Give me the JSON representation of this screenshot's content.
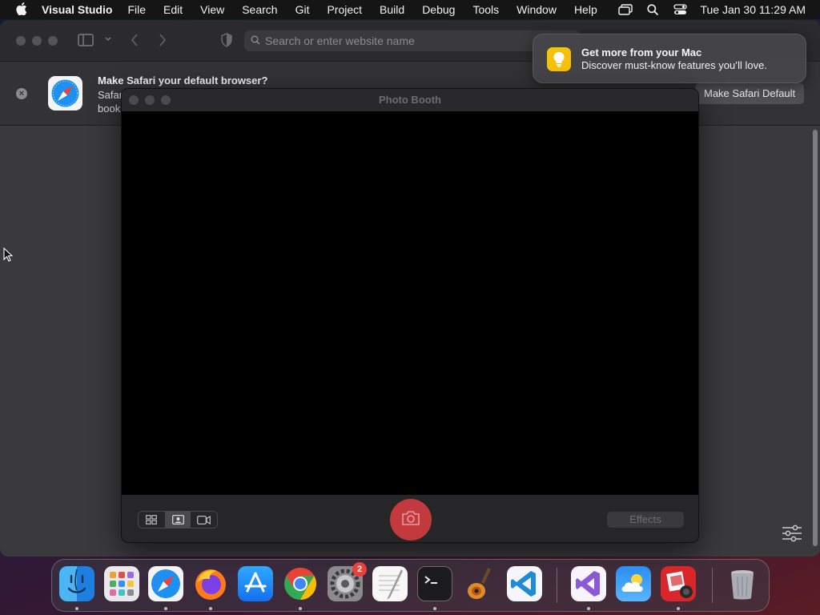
{
  "menubar": {
    "app_name": "Visual Studio",
    "items": [
      "File",
      "Edit",
      "View",
      "Search",
      "Git",
      "Project",
      "Build",
      "Debug",
      "Tools",
      "Window",
      "Help"
    ],
    "clock": "Tue Jan 30  11:29 AM"
  },
  "safari": {
    "address_placeholder": "Search or enter website name",
    "banner": {
      "title": "Make Safari your default browser?",
      "line1": "Safar",
      "line2": "book",
      "button": "Make Safari Default"
    }
  },
  "notification": {
    "title": "Get more from your Mac",
    "body": "Discover must-know features you’ll love."
  },
  "photobooth": {
    "title": "Photo Booth",
    "effects_label": "Effects"
  },
  "dock": {
    "settings_badge": "2",
    "apps": [
      "Finder",
      "Launchpad",
      "Safari",
      "Firefox",
      "App Store",
      "Chrome",
      "System Settings",
      "TextEdit",
      "Terminal",
      "GarageBand",
      "VS Code",
      "Visual Studio",
      "Weather",
      "Photo Booth",
      "Trash"
    ]
  },
  "colors": {
    "shutter": "#c23a3d",
    "notification_icon": "#f5c20b",
    "badge": "#e8403a"
  }
}
